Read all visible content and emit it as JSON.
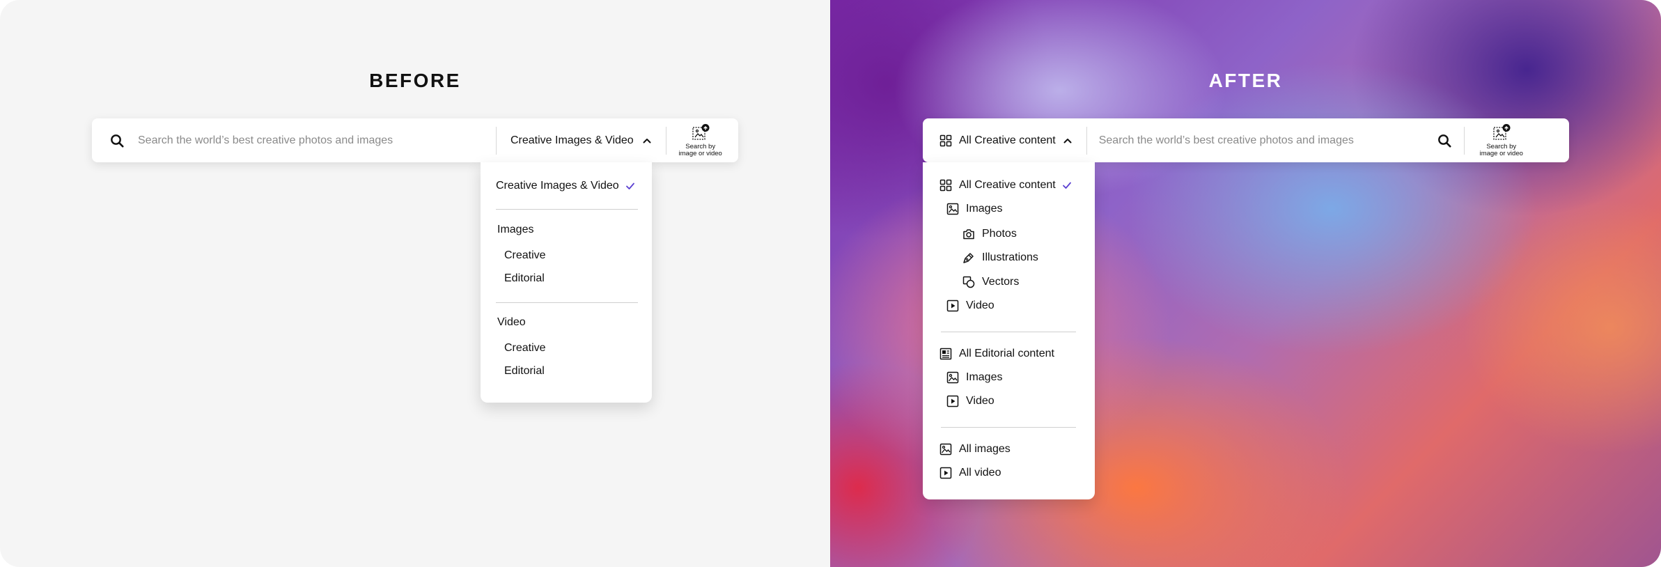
{
  "before": {
    "heading": "BEFORE",
    "search": {
      "placeholder": "Search the world’s best creative photos and images",
      "selected": "Creative Images & Video",
      "visual_search_line1": "Search by",
      "visual_search_line2": "image or video"
    },
    "dropdown": {
      "selected_item": "Creative Images & Video",
      "groups": [
        {
          "label": "Images",
          "items": [
            "Creative",
            "Editorial"
          ]
        },
        {
          "label": "Video",
          "items": [
            "Creative",
            "Editorial"
          ]
        }
      ]
    }
  },
  "after": {
    "heading": "AFTER",
    "search": {
      "selected": "All Creative content",
      "placeholder": "Search the world’s best creative photos and images",
      "visual_search_line1": "Search by",
      "visual_search_line2": "image or video"
    },
    "dropdown": {
      "creative": {
        "all": "All Creative content",
        "images": "Images",
        "photos": "Photos",
        "illustrations": "Illustrations",
        "vectors": "Vectors",
        "video": "Video"
      },
      "editorial": {
        "all": "All Editorial content",
        "images": "Images",
        "video": "Video"
      },
      "all_images": "All images",
      "all_video": "All video"
    }
  },
  "colors": {
    "accent": "#5a3fd1",
    "divider": "#d8d8d8"
  },
  "icons": [
    "search-icon",
    "chevron-up-icon",
    "visual-search-icon",
    "check-icon",
    "grid-icon",
    "image-icon",
    "camera-icon",
    "pen-icon",
    "vector-shapes-icon",
    "video-play-icon",
    "newspaper-icon"
  ]
}
